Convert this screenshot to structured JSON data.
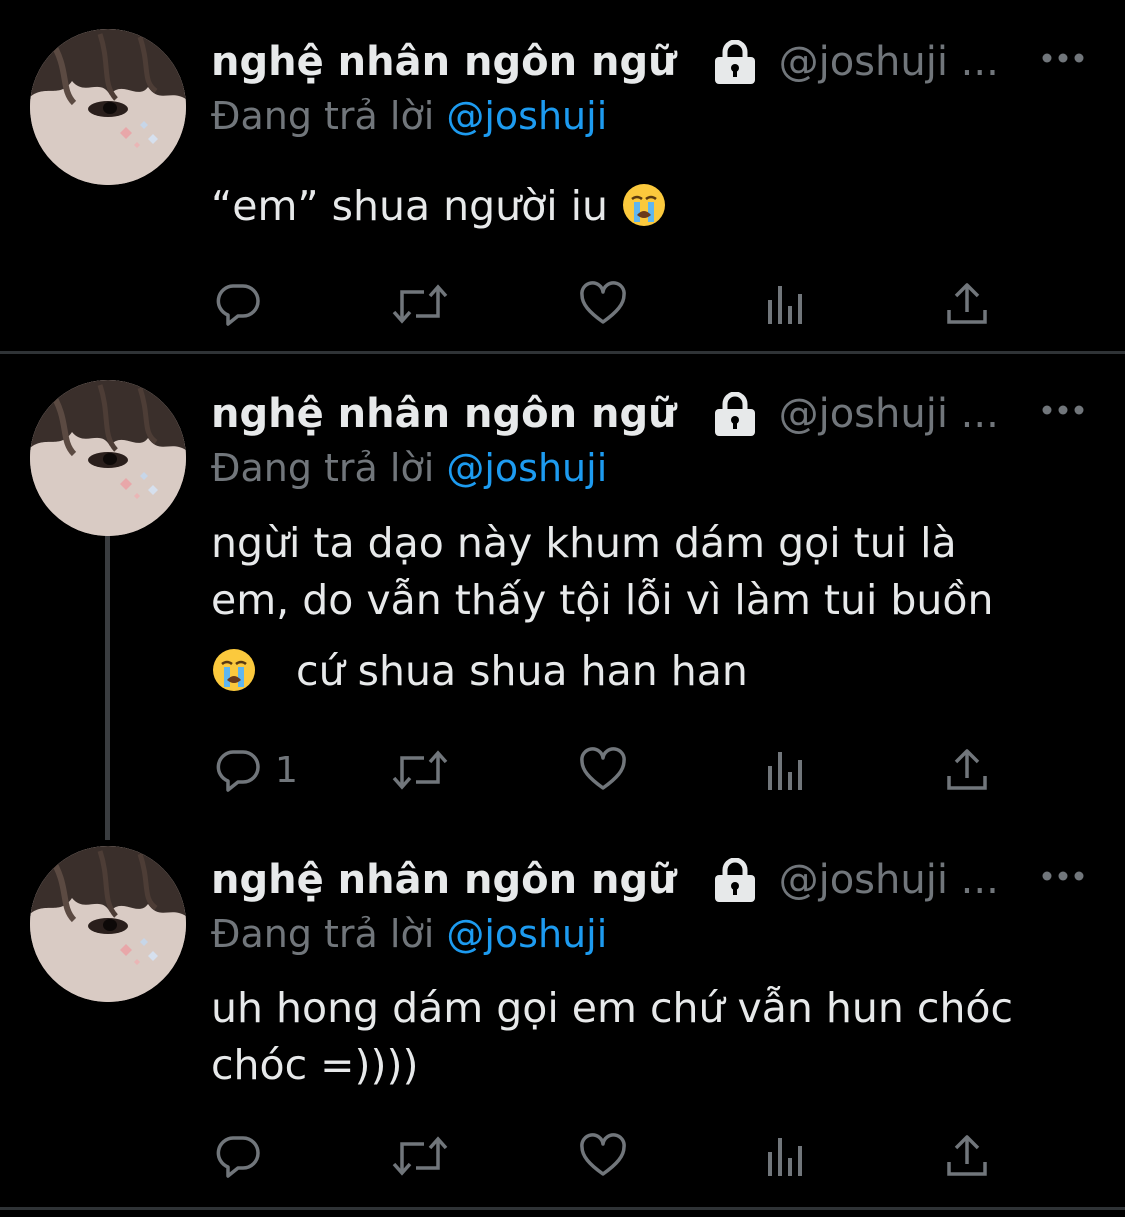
{
  "tweets": [
    {
      "display_name": "nghệ nhân ngôn ngữ",
      "handle": "@joshuji ...",
      "replying_prefix": "Đang trả lời ",
      "replying_to": "@joshuji",
      "text": "“em” shua người iu",
      "trailing_emoji": "loudly-crying-face",
      "reply_count": ""
    },
    {
      "display_name": "nghệ nhân ngôn ngữ",
      "handle": "@joshuji ...",
      "replying_prefix": "Đang trả lời ",
      "replying_to": "@joshuji",
      "text_line1": "ngừi ta dạo này khum dám gọi tui là",
      "text_line2": "em, do vẫn thấy tội lỗi vì làm tui buồn",
      "text_line3": "cứ shua shua han han",
      "leading_emoji": "loudly-crying-face",
      "reply_count": "1"
    },
    {
      "display_name": "nghệ nhân ngôn ngữ",
      "handle": "@joshuji ...",
      "replying_prefix": "Đang trả lời ",
      "replying_to": "@joshuji",
      "text_line1": "uh hong dám gọi em chứ vẫn hun chóc",
      "text_line2": "chóc =))))",
      "reply_count": ""
    }
  ],
  "icons": {
    "reply": "reply-icon",
    "retweet": "retweet-icon",
    "like": "heart-icon",
    "views": "views-icon",
    "share": "share-icon",
    "lock": "lock-icon",
    "more": "more-icon"
  },
  "colors": {
    "background": "#000000",
    "text": "#e7e9ea",
    "muted": "#71767b",
    "mention": "#1d9bf0",
    "divider": "#2f3336"
  }
}
